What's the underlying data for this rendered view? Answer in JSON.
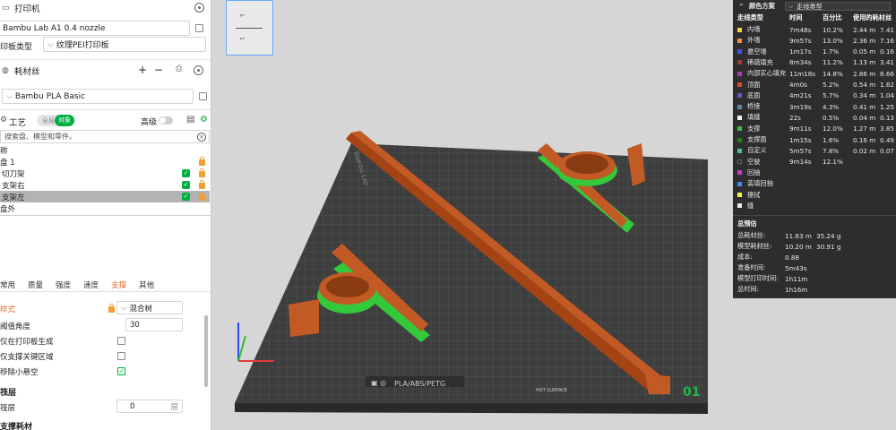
{
  "printer": {
    "section_title": "打印机",
    "name": "Bambu Lab A1 0.4 nozzle",
    "plate_type_label": "印板类型",
    "plate_type_value": "纹理PEI打印板"
  },
  "filament": {
    "section_title": "耗材丝",
    "add": "+",
    "remove": "−",
    "value": "Bambu PLA Basic"
  },
  "process": {
    "section_title": "工艺",
    "toggle_off": "全局",
    "toggle_on": "对象",
    "advanced_label": "高级"
  },
  "search": {
    "placeholder": "搜索盘、模型和零件。"
  },
  "tree": {
    "header": "称",
    "plate": "盘 1",
    "items": [
      "切刀架",
      "支架右",
      "支架左"
    ],
    "outside": "盘外"
  },
  "tabs": [
    "常用",
    "质量",
    "强度",
    "速度",
    "支撑",
    "其他"
  ],
  "support": {
    "style_label": "样式",
    "style_value": "混合树",
    "threshold_label": "阈值角度",
    "threshold_value": "30",
    "only_plate_label": "仅在打印板生成",
    "critical_only_label": "仅支撑关键区域",
    "remove_small_label": "移除小悬空",
    "raft_group": "筏层",
    "raft_layers_label": "筏层",
    "raft_layers_value": "0",
    "raft_unit": "层",
    "filament_group": "支撑耗材"
  },
  "bed": {
    "brand": "Bambu Lab",
    "material_label": "PLA/ABS/PETG",
    "plate_number": "01",
    "corner_text": "HOT SURFACE"
  },
  "legend": {
    "title": "颜色方案",
    "scheme_value": "走线类型",
    "headers": [
      "走线类型",
      "时间",
      "百分比",
      "使用的耗材丝"
    ],
    "rows": [
      {
        "name": "内墙",
        "color": "#f5d23a",
        "time": "7m48s",
        "pct": "10.2%",
        "len": "2.44 m",
        "wt": "7.41 g"
      },
      {
        "name": "外墙",
        "color": "#f58f3a",
        "time": "9m57s",
        "pct": "13.0%",
        "len": "2.36 m",
        "wt": "7.16 g"
      },
      {
        "name": "悬空墙",
        "color": "#3a55f5",
        "time": "1m17s",
        "pct": "1.7%",
        "len": "0.05 m",
        "wt": "0.16 g"
      },
      {
        "name": "稀疏填充",
        "color": "#a83a3a",
        "time": "8m34s",
        "pct": "11.2%",
        "len": "1.13 m",
        "wt": "3.41 g"
      },
      {
        "name": "内部实心填充",
        "color": "#b03ab0",
        "time": "11m18s",
        "pct": "14.8%",
        "len": "2.86 m",
        "wt": "8.66 g"
      },
      {
        "name": "顶面",
        "color": "#e0423a",
        "time": "4m0s",
        "pct": "5.2%",
        "len": "0.54 m",
        "wt": "1.62 g"
      },
      {
        "name": "底面",
        "color": "#6f4fd0",
        "time": "4m21s",
        "pct": "5.7%",
        "len": "0.34 m",
        "wt": "1.04 g"
      },
      {
        "name": "桥接",
        "color": "#5a86a8",
        "time": "3m19s",
        "pct": "4.3%",
        "len": "0.41 m",
        "wt": "1.25 g"
      },
      {
        "name": "填缝",
        "color": "#f5f5f5",
        "time": "22s",
        "pct": "0.5%",
        "len": "0.04 m",
        "wt": "0.13 g"
      },
      {
        "name": "支撑",
        "color": "#36c03a",
        "time": "9m11s",
        "pct": "12.0%",
        "len": "1.27 m",
        "wt": "3.85 g"
      },
      {
        "name": "支撑面",
        "color": "#1f7f1f",
        "time": "1m15s",
        "pct": "1.6%",
        "len": "0.16 m",
        "wt": "0.49 g"
      },
      {
        "name": "自定义",
        "color": "#4fbf9f",
        "time": "5m57s",
        "pct": "7.8%",
        "len": "0.02 m",
        "wt": "0.07 g"
      },
      {
        "name": "空驶",
        "color": "#2d2d2d",
        "time": "9m14s",
        "pct": "12.1%",
        "len": "",
        "wt": ""
      },
      {
        "name": "回抽",
        "color": "#c83ac8",
        "time": "",
        "pct": "",
        "len": "",
        "wt": ""
      },
      {
        "name": "装填回抽",
        "color": "#3a8ff5",
        "time": "",
        "pct": "",
        "len": "",
        "wt": ""
      },
      {
        "name": "擦拭",
        "color": "#f5f53a",
        "time": "",
        "pct": "",
        "len": "",
        "wt": ""
      },
      {
        "name": "缝",
        "color": "#eaeaea",
        "time": "",
        "pct": "",
        "len": "",
        "wt": ""
      }
    ],
    "summary_title": "总预估",
    "summary": [
      {
        "label": "总耗材丝:",
        "v1": "11.63 m",
        "v2": "35.24 g"
      },
      {
        "label": "模型耗材丝:",
        "v1": "10.20 m",
        "v2": "30.91 g"
      },
      {
        "label": "成本:",
        "v1": "0.88",
        "v2": ""
      },
      {
        "label": "准备时间:",
        "v1": "5m43s",
        "v2": ""
      },
      {
        "label": "模型打印时间:",
        "v1": "1h11m",
        "v2": ""
      },
      {
        "label": "总时间:",
        "v1": "1h16m",
        "v2": ""
      }
    ]
  }
}
